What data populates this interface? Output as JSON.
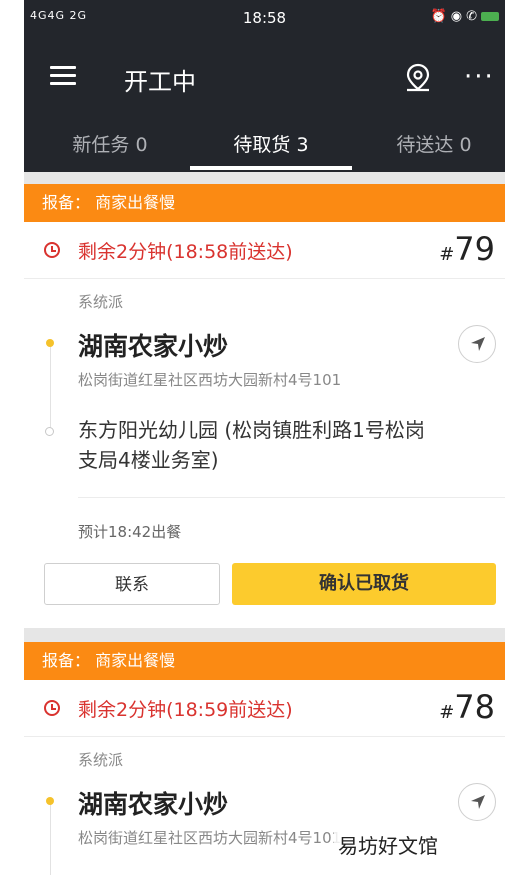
{
  "status_bar": {
    "signal": "4G4G 2G",
    "time": "18:58",
    "icons": [
      "alarm-icon",
      "location-icon",
      "call-hd-icon",
      "battery-icon"
    ],
    "battery_color": "#4caf50"
  },
  "header": {
    "title": "开工中",
    "background": "#23262c"
  },
  "tabs": [
    {
      "label": "新任务 0",
      "active": false
    },
    {
      "label": "待取货 3",
      "active": true
    },
    {
      "label": "待送达 0",
      "active": false
    }
  ],
  "orders": [
    {
      "notice": "报备：  商家出餐慢",
      "deadline": "剩余2分钟(18:58前送达)",
      "hash": "#",
      "number": "79",
      "dispatch": "系统派",
      "store_name": "湖南农家小炒",
      "store_address": "松岗街道红星社区西坊大园新村4号101",
      "destination": "东方阳光幼儿园 (松岗镇胜利路1号松岗支局4楼业务室)",
      "eta": "预计18:42出餐",
      "contact_label": "联系",
      "confirm_label": "确认已取货"
    },
    {
      "notice": "报备：  商家出餐慢",
      "deadline": "剩余2分钟(18:59前送达)",
      "hash": "#",
      "number": "78",
      "dispatch": "系统派",
      "store_name": "湖南农家小炒",
      "store_address": "松岗街道红星社区西坊大园新村4号101"
    }
  ],
  "colors": {
    "notice_orange": "#fb8a13",
    "deadline_red": "#d9332f",
    "confirm_yellow": "#fccb2d",
    "store_dot": "#f5c22b"
  },
  "watermark": "易坊好文馆"
}
